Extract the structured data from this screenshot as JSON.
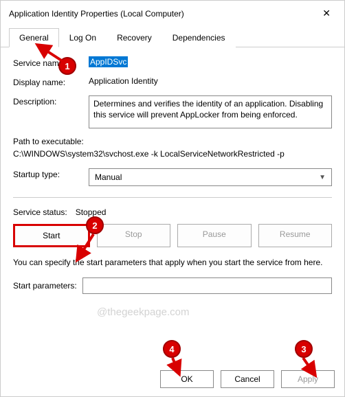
{
  "window": {
    "title": "Application Identity Properties (Local Computer)",
    "close": "✕"
  },
  "tabs": [
    {
      "label": "General",
      "active": true
    },
    {
      "label": "Log On",
      "active": false
    },
    {
      "label": "Recovery",
      "active": false
    },
    {
      "label": "Dependencies",
      "active": false
    }
  ],
  "fields": {
    "service_name_label": "Service name:",
    "service_name_value": "AppIDSvc",
    "display_name_label": "Display name:",
    "display_name_value": "Application Identity",
    "description_label": "Description:",
    "description_value": "Determines and verifies the identity of an application. Disabling this service will prevent AppLocker from being enforced.",
    "path_label": "Path to executable:",
    "path_value": "C:\\WINDOWS\\system32\\svchost.exe -k LocalServiceNetworkRestricted -p",
    "startup_type_label": "Startup type:",
    "startup_type_value": "Manual",
    "service_status_label": "Service status:",
    "service_status_value": "Stopped",
    "hint": "You can specify the start parameters that apply when you start the service from here.",
    "start_params_label": "Start parameters:",
    "start_params_value": ""
  },
  "svc_buttons": {
    "start": "Start",
    "stop": "Stop",
    "pause": "Pause",
    "resume": "Resume"
  },
  "dlg_buttons": {
    "ok": "OK",
    "cancel": "Cancel",
    "apply": "Apply"
  },
  "watermark": "@thegeekpage.com",
  "annotations": {
    "b1": "1",
    "b2": "2",
    "b3": "3",
    "b4": "4"
  }
}
